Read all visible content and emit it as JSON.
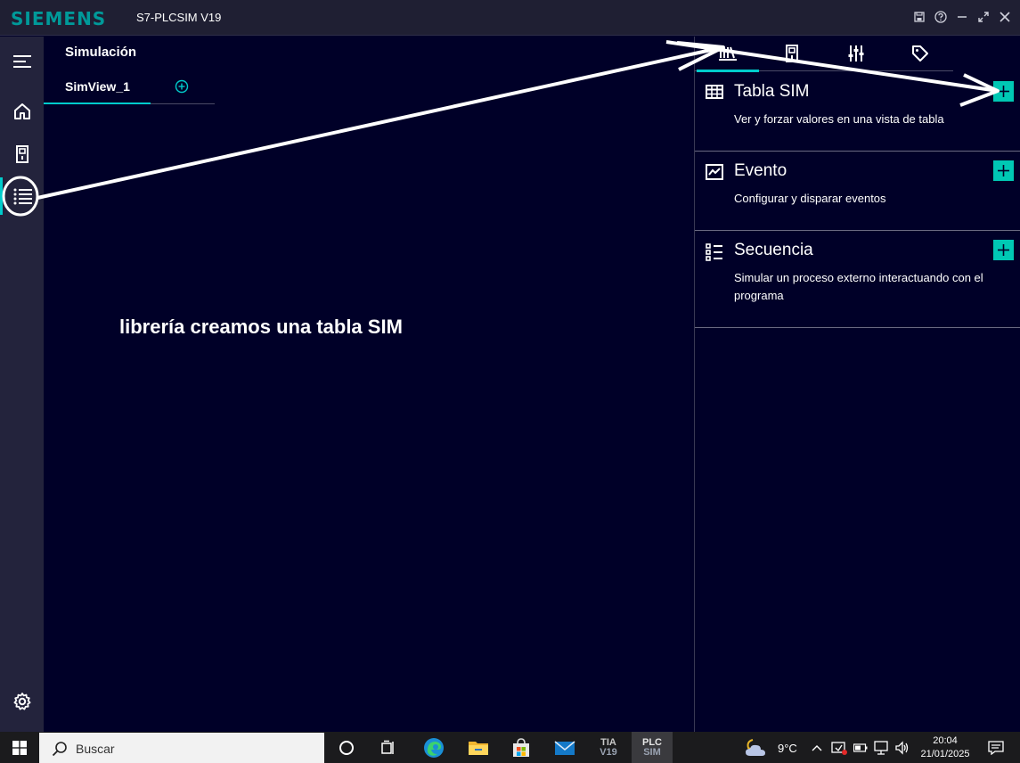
{
  "titlebar": {
    "logo": "SIEMENS",
    "app_title": "S7-PLCSIM V19",
    "controls": [
      "save-icon",
      "help-icon",
      "minimize-icon",
      "maximize-icon",
      "close-icon"
    ]
  },
  "leftnav": {
    "items": [
      {
        "icon": "menu-icon"
      },
      {
        "icon": "home-icon"
      },
      {
        "icon": "device-icon"
      },
      {
        "icon": "list-icon",
        "active": true
      }
    ],
    "bottom": {
      "icon": "gear-icon"
    }
  },
  "simulation": {
    "title": "Simulación",
    "tab": "SimView_1",
    "add_tab_icon": "add-circle-icon"
  },
  "annotation": {
    "text": "librería creamos una tabla SIM"
  },
  "right_panel": {
    "tabs": [
      "library-icon",
      "device-icon",
      "sliders-icon",
      "tag-icon"
    ],
    "active_tab": 0,
    "cards": [
      {
        "icon": "table-icon",
        "title": "Tabla SIM",
        "desc": "Ver y forzar valores en una vista de tabla"
      },
      {
        "icon": "chart-icon",
        "title": "Evento",
        "desc": "Configurar y disparar eventos"
      },
      {
        "icon": "sequence-icon",
        "title": "Secuencia",
        "desc": "Simular un proceso externo interactuando con el programa"
      }
    ]
  },
  "taskbar": {
    "search_placeholder": "Buscar",
    "apps": [
      "task-view-icon",
      "taskbar-grid-icon",
      "edge-icon",
      "explorer-icon",
      "store-icon",
      "mail-icon",
      "tia-icon",
      "plcsim-icon"
    ],
    "tia_label": [
      "TIA",
      "V19"
    ],
    "plcsim_label": [
      "PLC",
      "SIM"
    ],
    "temperature": "9°C",
    "time": "20:04",
    "date": "21/01/2025"
  },
  "colors": {
    "accent": "#00cccc",
    "background": "#000028",
    "add_button": "#00c8b4"
  }
}
